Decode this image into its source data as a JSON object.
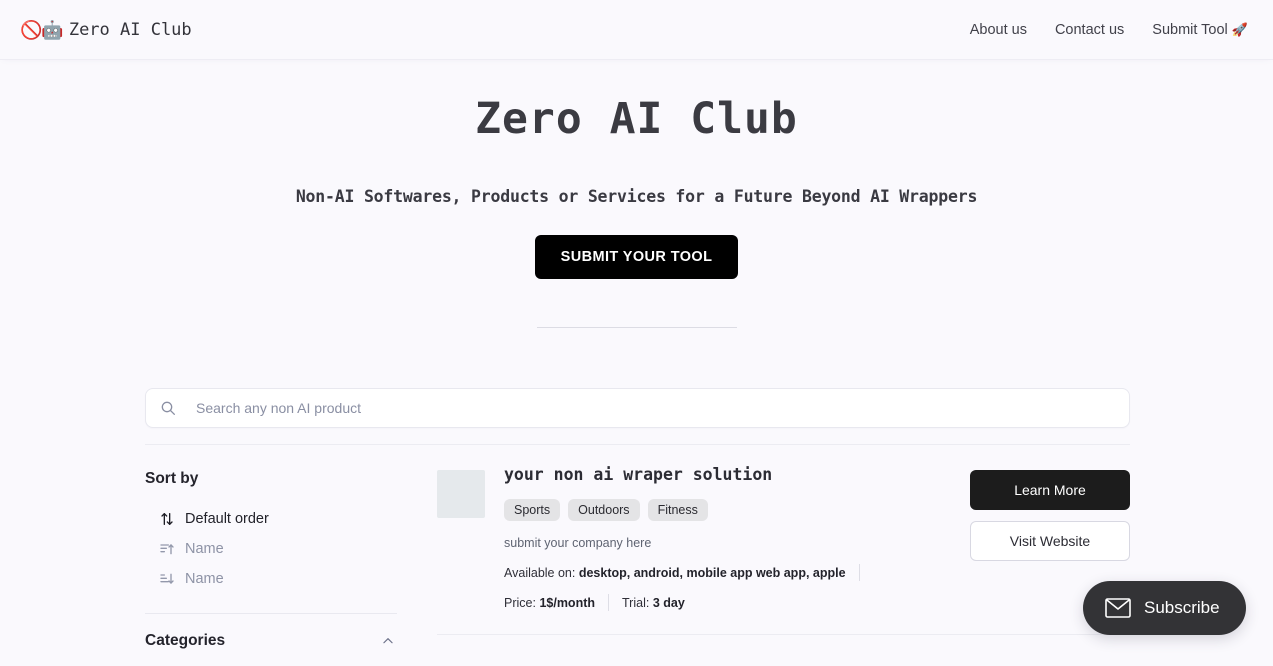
{
  "header": {
    "brand": {
      "emoji": "🚫🤖",
      "name": "Zero AI Club"
    },
    "nav": [
      {
        "label": "About us"
      },
      {
        "label": "Contact us"
      },
      {
        "label": "Submit Tool",
        "emoji": "🚀"
      }
    ]
  },
  "hero": {
    "title": "Zero AI Club",
    "subtitle": "Non-AI Softwares, Products or Services for a Future Beyond AI Wrappers",
    "cta_label": "SUBMIT YOUR TOOL"
  },
  "search": {
    "placeholder": "Search any non AI product",
    "value": "",
    "icon": "search-icon"
  },
  "sidebar": {
    "sort_heading": "Sort by",
    "sort_options": [
      {
        "label": "Default order",
        "icon": "arrows-up-down-icon",
        "state": "active"
      },
      {
        "label": "Name",
        "icon": "sort-ascending-icon",
        "state": "muted"
      },
      {
        "label": "Name",
        "icon": "sort-descending-icon",
        "state": "muted"
      }
    ],
    "categories_label": "Categories",
    "categories_icon": "chevron-up-icon"
  },
  "product": {
    "title": "your non ai wraper solution",
    "tags": [
      "Sports",
      "Outdoors",
      "Fitness"
    ],
    "description": "submit your company here",
    "available_label": "Available on:",
    "available_value": "desktop, android, mobile app web app, apple",
    "price_label": "Price:",
    "price_value": "1$/month",
    "trial_label": "Trial:",
    "trial_value": "3 day",
    "primary_button": "Learn More",
    "secondary_button": "Visit Website"
  },
  "subscribe": {
    "label": "Subscribe",
    "icon": "envelope-icon"
  },
  "colors": {
    "page_bg": "#faf9fd",
    "cta_bg": "#000000",
    "primary_btn_bg": "#1c1c1c",
    "subscribe_bg": "#333336",
    "tag_bg": "#e4e4e6",
    "thumb_bg": "#e5e9ec"
  }
}
